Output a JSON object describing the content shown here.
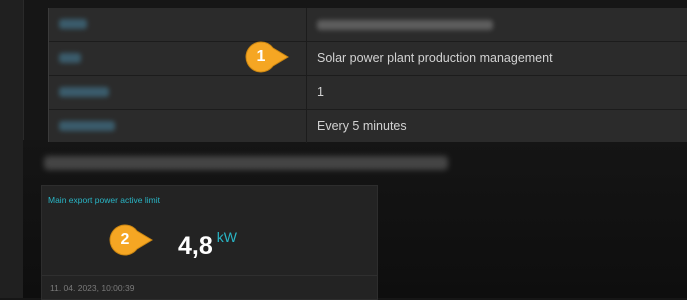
{
  "info_table": {
    "rows": [
      {
        "value": ""
      },
      {
        "value": "Solar power plant production management"
      },
      {
        "value": "1"
      },
      {
        "value": "Every 5 minutes"
      }
    ]
  },
  "widget": {
    "title": "Main export power active limit",
    "value": "4,8",
    "unit": "kW",
    "timestamp": "11. 04. 2023, 10:00:39"
  },
  "callouts": [
    {
      "label": "1"
    },
    {
      "label": "2"
    }
  ],
  "colors": {
    "accent": "#29b6c6",
    "callout": "#f5a623"
  }
}
